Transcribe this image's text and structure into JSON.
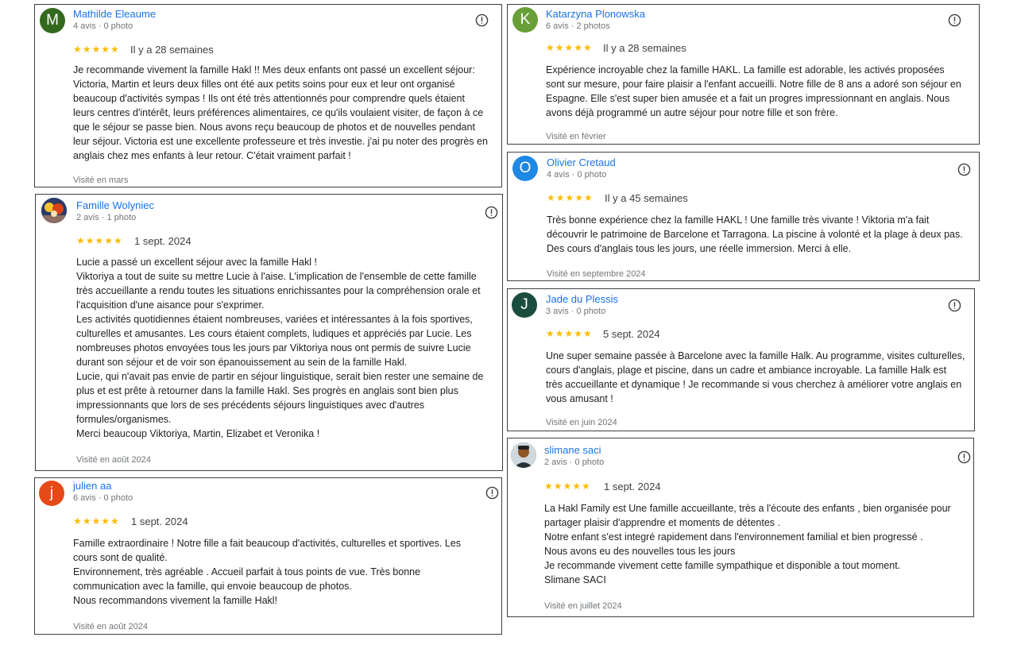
{
  "reviews": [
    {
      "initial": "M",
      "avatar_color": "#33691e",
      "name": "Mathilde Eleaume",
      "meta": "4 avis · 0 photo",
      "stars": "★★★★★",
      "date": "Il y a 28 semaines",
      "lines": [
        "Je recommande vivement la famille Hakl !! Mes deux enfants ont passé un excellent séjour:",
        "Victoria, Martin et leurs deux filles ont été aux petits soins pour eux et leur ont organisé",
        "beaucoup d'activités sympas ! Ils ont été très attentionnés pour comprendre quels étaient",
        "leurs centres d'intérêt, leurs préférences alimentaires, ce qu'ils voulaient visiter, de façon à ce",
        "que le séjour se passe bien. Nous avons reçu beaucoup de photos et de nouvelles pendant",
        "leur séjour. Victoria est une excellente professeure et très investie. j'ai pu noter des progrès en",
        "anglais chez mes enfants à leur retour. C'était vraiment parfait !"
      ],
      "visited": "Visité en mars"
    },
    {
      "initial": "",
      "avatar_color": "#5c6bc0",
      "name": "Famille Wolyniec",
      "meta": "2 avis · 1 photo",
      "stars": "★★★★★",
      "date": "1 sept. 2024",
      "lines": [
        "Lucie a passé un excellent séjour avec la famille Hakl !",
        "Viktoriya a tout de suite su mettre Lucie à l'aise. L'implication de l'ensemble de cette famille",
        "très accueillante a rendu toutes les situations enrichissantes pour la compréhension orale et",
        "l'acquisition d'une aisance pour s'exprimer.",
        "Les activités quotidiennes étaient nombreuses, variées et intéressantes à la fois sportives,",
        "culturelles et amusantes. Les cours étaient complets, ludiques et appréciés par Lucie. Les",
        "nombreuses photos envoyées tous les jours par Viktoriya nous ont permis de suivre Lucie",
        "durant son séjour et de voir son épanouissement au sein de la famille Hakl.",
        "Lucie, qui n'avait pas envie de partir en séjour linguistique, serait bien rester une semaine de",
        "plus et est prête à retourner dans la famille Hakl. Ses progrès en anglais sont bien plus",
        "impressionnants que lors de ses précédents séjours linguistiques avec d'autres",
        "formules/organismes.",
        "Merci beaucoup Viktoriya, Martin, Elizabet et Veronika !"
      ],
      "visited": "Visité en août 2024"
    },
    {
      "initial": "j",
      "avatar_color": "#e64a19",
      "name": "julien aa",
      "meta": "6 avis · 0 photo",
      "stars": "★★★★★",
      "date": "1 sept. 2024",
      "lines": [
        "Famille extraordinaire ! Notre fille a fait beaucoup d'activités, culturelles et sportives. Les",
        "cours sont de qualité.",
        "Environnement, très agréable . Accueil parfait à tous points de vue. Très bonne",
        "communication avec la famille, qui envoie beaucoup de photos.",
        "Nous recommandons vivement la famille Hakl!"
      ],
      "visited": "Visité en août 2024"
    },
    {
      "initial": "K",
      "avatar_color": "#689f38",
      "name": "Katarzyna Plonowska",
      "meta": "6 avis · 2 photos",
      "stars": "★★★★★",
      "date": "Il y a 28 semaines",
      "lines": [
        "Expérience incroyable chez la famille HAKL. La famille est adorable, les activés proposées",
        "sont sur mesure, pour faire plaisir a l'enfant accueilli. Notre fille de 8 ans a adoré son séjour en",
        "Espagne. Elle s'est super bien amusée et a fait un progres impressionnant en anglais. Nous",
        "avons déjà programmé un autre séjour pour notre fille et son frère."
      ],
      "visited": "Visité en février"
    },
    {
      "initial": "O",
      "avatar_color": "#1e88e5",
      "name": "Olivier Cretaud",
      "meta": "4 avis · 0 photo",
      "stars": "★★★★★",
      "date": "Il y a 45 semaines",
      "lines": [
        "Très bonne expérience chez la famille HAKL ! Une famille très vivante ! Viktoria m'a fait",
        "découvrir le patrimoine de Barcelone et Tarragona. La piscine à volonté et la plage à deux pas.",
        "Des cours d'anglais tous les jours, une réelle immersion. Merci à elle."
      ],
      "visited": "Visité en septembre 2024"
    },
    {
      "initial": "J",
      "avatar_color": "#1b4d3e",
      "name": "Jade du Plessis",
      "meta": "3 avis · 0 photo",
      "stars": "★★★★★",
      "date": "5 sept. 2024",
      "lines": [
        "Une super semaine passée à Barcelone avec la famille Halk. Au programme, visites culturelles,",
        "cours d'anglais, plage et piscine, dans un cadre et ambiance incroyable. La famille Halk est",
        "très accueillante et dynamique ! Je recommande si vous cherchez à améliorer votre anglais en",
        "vous amusant !"
      ],
      "visited": "Visité en juin 2024"
    },
    {
      "initial": "",
      "avatar_color": "#455a64",
      "name": "slimane saci",
      "meta": "2 avis · 0 photo",
      "stars": "★★★★★",
      "date": "1 sept. 2024",
      "lines": [
        "La Hakl Family est Une famille accueillante, très a l'écoute des enfants , bien organisée pour",
        "partager plaisir d'apprendre et moments de détentes .",
        "Notre enfant s'est integré rapidement dans l'environnement familial et bien progressé .",
        "Nous avons eu des nouvelles tous les jours",
        "Je recommande vivement cette famille sympathique et disponible a tout moment.",
        "Slimane SACI"
      ],
      "visited": "Visité en juillet 2024"
    }
  ]
}
